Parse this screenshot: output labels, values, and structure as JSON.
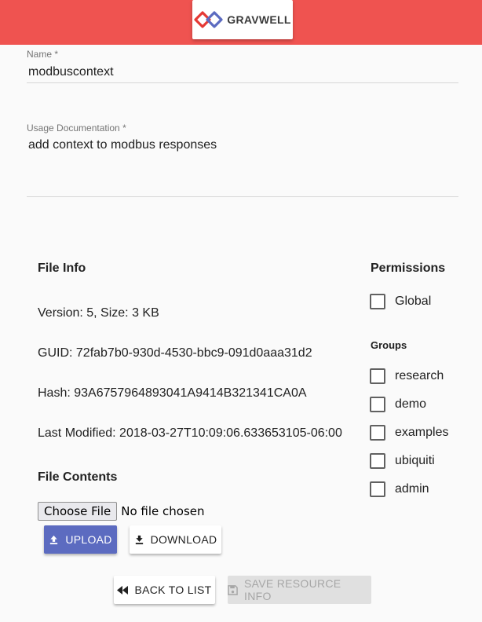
{
  "app": {
    "logo_text": "GRAVWELL",
    "accent": "#ef5350",
    "primary": "#5c6bc0"
  },
  "form": {
    "name_label": "Name *",
    "name_value": "modbuscontext",
    "doc_label": "Usage Documentation *",
    "doc_value": "add context to modbus responses"
  },
  "file_info": {
    "heading": "File Info",
    "version_line": "Version: 5, Size: 3 KB",
    "guid_line": "GUID: 72fab7b0-930d-4530-bbc9-091d0aaa31d2",
    "hash_line": "Hash: 93A6757964893041A9414B321341CA0A",
    "modified_line": "Last Modified: 2018-03-27T10:09:06.633653105-06:00"
  },
  "file_contents": {
    "heading": "File Contents",
    "choose_label": "Choose File",
    "no_file_text": "No file chosen",
    "upload_label": "UPLOAD",
    "download_label": "DOWNLOAD"
  },
  "permissions": {
    "heading": "Permissions",
    "global_label": "Global",
    "global_checked": false,
    "groups_heading": "Groups",
    "groups": [
      {
        "label": "research",
        "checked": false
      },
      {
        "label": "demo",
        "checked": false
      },
      {
        "label": "examples",
        "checked": false
      },
      {
        "label": "ubiquiti",
        "checked": false
      },
      {
        "label": "admin",
        "checked": false
      }
    ]
  },
  "actions": {
    "back_label": "BACK TO LIST",
    "save_label": "SAVE RESOURCE INFO",
    "save_enabled": false
  },
  "icons": {
    "logo": "gravwell-logo-icon",
    "upload": "upload-icon",
    "download": "download-icon",
    "back": "rewind-icon",
    "save": "save-icon"
  }
}
